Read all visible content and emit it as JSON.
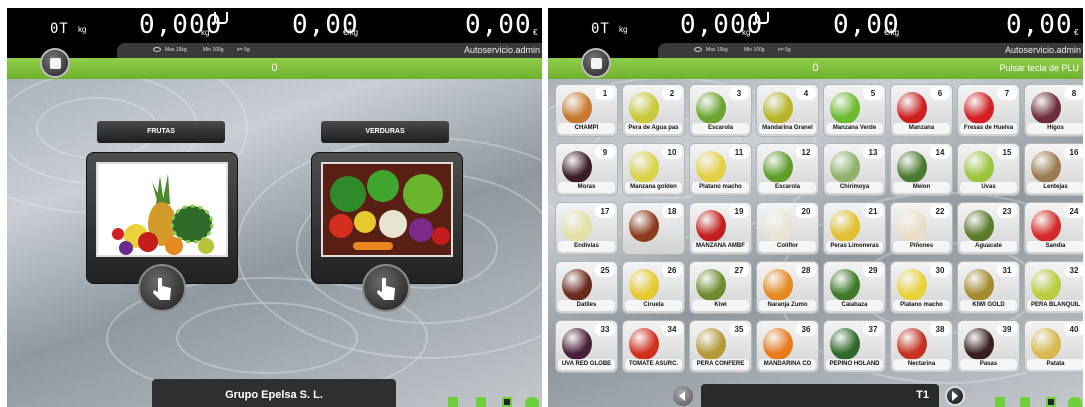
{
  "left": {
    "display": {
      "tare_label": "0T",
      "kg_small": "kg",
      "weight": "0,000",
      "weight_unit": "kg",
      "price_per_kg": "0,00",
      "price_unit": "€/kg",
      "total": "0,00",
      "total_unit": "€"
    },
    "info": {
      "max": "Max 15kg",
      "min": "Min 100g",
      "e": "e= 5g",
      "user": "Autoservicio.admin"
    },
    "status": {
      "count": "0"
    },
    "categories": [
      {
        "label": "FRUTAS"
      },
      {
        "label": "VERDURAS"
      }
    ],
    "footer": {
      "company": "Grupo Epelsa S. L."
    }
  },
  "right": {
    "display": {
      "tare_label": "0T",
      "kg_small": "kg",
      "weight": "0,000",
      "weight_unit": "kg",
      "price_per_kg": "0,00",
      "price_unit": "€/kg",
      "total": "0,00",
      "total_unit": "€"
    },
    "info": {
      "max": "Max 15kg",
      "min": "Min 100g",
      "e": "e= 5g",
      "user": "Autoservicio.admin"
    },
    "status": {
      "count": "0",
      "prompt": "Pulsar tecla de PLU"
    },
    "plus": [
      {
        "num": "1",
        "name": "CHAMPI",
        "color": "#c9792f"
      },
      {
        "num": "2",
        "name": "Pera de Agua pas",
        "color": "#c8c83a"
      },
      {
        "num": "3",
        "name": "Escarola",
        "color": "#6aa52d"
      },
      {
        "num": "4",
        "name": "Mandarina Granel",
        "color": "#b7b42a"
      },
      {
        "num": "5",
        "name": "Manzana Verde",
        "color": "#6cbb2f"
      },
      {
        "num": "6",
        "name": "Manzana",
        "color": "#cc1f1f"
      },
      {
        "num": "7",
        "name": "Fresas de Huelva",
        "color": "#d31f24"
      },
      {
        "num": "8",
        "name": "Higos",
        "color": "#6e2c3a"
      },
      {
        "num": "9",
        "name": "Moras",
        "color": "#3b1d2a"
      },
      {
        "num": "10",
        "name": "Manzana golden",
        "color": "#d9d34a"
      },
      {
        "num": "11",
        "name": "Platano macho",
        "color": "#e4d044"
      },
      {
        "num": "12",
        "name": "Escarola",
        "color": "#5f9e2a"
      },
      {
        "num": "13",
        "name": "Chirimoya",
        "color": "#8fb36a"
      },
      {
        "num": "14",
        "name": "Melon",
        "color": "#4a7a2f"
      },
      {
        "num": "15",
        "name": "Uvas",
        "color": "#9cc43e"
      },
      {
        "num": "16",
        "name": "Lentejas",
        "color": "#9a7a4e"
      },
      {
        "num": "17",
        "name": "Endivias",
        "color": "#e3e0a4"
      },
      {
        "num": "18",
        "name": "",
        "color": "#8b3b1e"
      },
      {
        "num": "19",
        "name": "MANZANA AMBF",
        "color": "#c41d1d"
      },
      {
        "num": "20",
        "name": "Coliflor",
        "color": "#e8e4d2"
      },
      {
        "num": "21",
        "name": "Peras Limoneras",
        "color": "#e1c02f"
      },
      {
        "num": "22",
        "name": "Piñones",
        "color": "#eadfc6"
      },
      {
        "num": "23",
        "name": "Aguacate",
        "color": "#5b7a2a"
      },
      {
        "num": "24",
        "name": "Sandia",
        "color": "#d62a2a"
      },
      {
        "num": "25",
        "name": "Datiles",
        "color": "#6a2a1d"
      },
      {
        "num": "26",
        "name": "Ciruela",
        "color": "#e6c82f"
      },
      {
        "num": "27",
        "name": "Kiwi",
        "color": "#6e8c2d"
      },
      {
        "num": "28",
        "name": "Naranja Zumo",
        "color": "#e58a21"
      },
      {
        "num": "29",
        "name": "Calabaza",
        "color": "#3f7a2a"
      },
      {
        "num": "30",
        "name": "Platano macho",
        "color": "#e8d23a"
      },
      {
        "num": "31",
        "name": "KIWI GOLD",
        "color": "#a58a2e"
      },
      {
        "num": "32",
        "name": "PERA BLANQUIL",
        "color": "#b9cc3e"
      },
      {
        "num": "33",
        "name": "UVA RED GLOBE",
        "color": "#4a1f3a"
      },
      {
        "num": "34",
        "name": "TOMATE ASURC.",
        "color": "#d22f1f"
      },
      {
        "num": "35",
        "name": "PERA CONFERE",
        "color": "#b59a3a"
      },
      {
        "num": "36",
        "name": "MANDARINA CO",
        "color": "#e87b1e"
      },
      {
        "num": "37",
        "name": "PEPINO HOLAND",
        "color": "#2f6a2a"
      },
      {
        "num": "38",
        "name": "Nectarina",
        "color": "#c6321f"
      },
      {
        "num": "39",
        "name": "Pasas",
        "color": "#3a1f1f"
      },
      {
        "num": "40",
        "name": "Patata",
        "color": "#d9b84e"
      }
    ],
    "footer": {
      "plu": "T1"
    }
  },
  "colors": {
    "green": "#7cc03a",
    "black": "#000000",
    "dark": "#2a2a2a"
  }
}
